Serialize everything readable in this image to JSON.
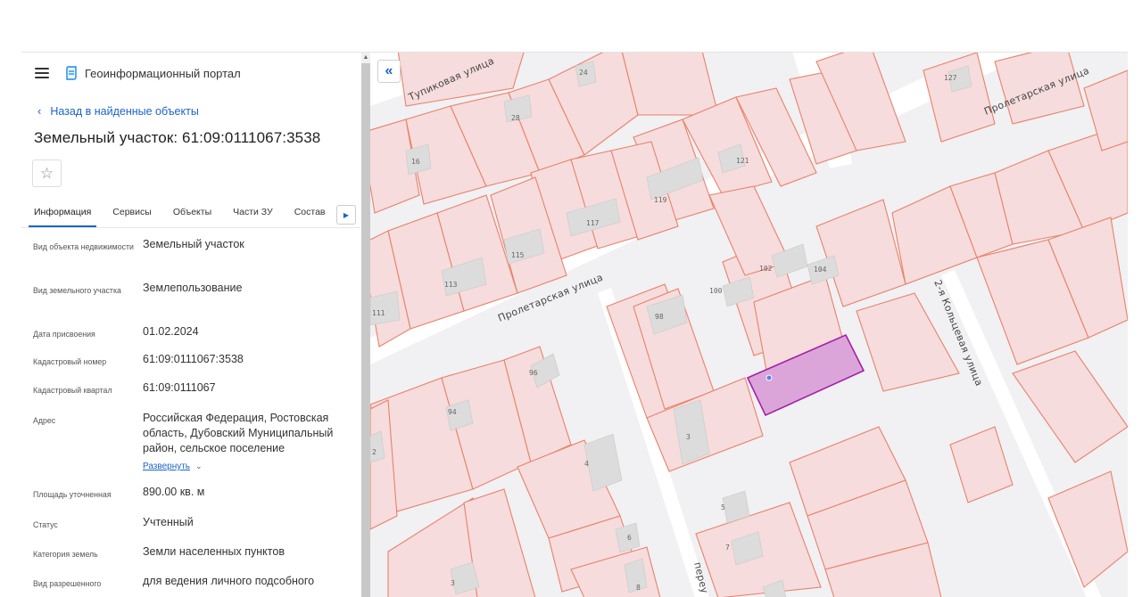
{
  "header": {
    "app_title": "Геоинформационный портал",
    "back_label": "Назад в найденные объекты",
    "page_title": "Земельный участок: 61:09:0111067:3538"
  },
  "tabs": [
    "Информация",
    "Сервисы",
    "Объекты",
    "Части ЗУ",
    "Состав"
  ],
  "properties": [
    {
      "label": "Вид объекта недвижимости",
      "value": "Земельный участок"
    },
    {
      "label": "Вид земельного участка",
      "value": "Землепользование"
    },
    {
      "label": "Дата присвоения",
      "value": "01.02.2024"
    },
    {
      "label": "Кадастровый номер",
      "value": "61:09:0111067:3538"
    },
    {
      "label": "Кадастровый квартал",
      "value": "61:09:0111067"
    },
    {
      "label": "Адрес",
      "value": "Российская Федерация, Ростовская область, Дубовский Муниципальный район, сельское поселение",
      "expand": "Развернуть"
    },
    {
      "label": "Площадь уточненная",
      "value": "890.00 кв. м"
    },
    {
      "label": "Статус",
      "value": "Учтенный"
    },
    {
      "label": "Категория земель",
      "value": "Земли населенных пунктов"
    },
    {
      "label": "Вид разрешенного",
      "value": "для ведения личного подсобного"
    }
  ],
  "map": {
    "streets": [
      "Тупиковая улица",
      "Пролетарская улица",
      "Пролетарская улица",
      "2-я Кольцевая улица",
      "переу"
    ],
    "numbers": [
      "24",
      "28",
      "16",
      "121",
      "119",
      "117",
      "115",
      "113",
      "111",
      "127",
      "102",
      "104",
      "100",
      "98",
      "96",
      "94",
      "3",
      "4",
      "5",
      "6",
      "7",
      "8",
      "2",
      "3"
    ],
    "colors": {
      "parcel_stroke": "#e8826a",
      "parcel_fill": "#f6dcdc",
      "selected_fill": "#d9a0d6",
      "selected_stroke": "#a51fa8",
      "building_fill": "#dddddd"
    }
  },
  "icons": {
    "menu": "menu-icon",
    "logo": "portal-logo-icon",
    "back": "chevron-left-icon",
    "favorite": "star-icon",
    "collapse": "double-chevron-left-icon",
    "tabs_scroll": "chevron-right-icon",
    "expand": "chevron-down-icon"
  }
}
